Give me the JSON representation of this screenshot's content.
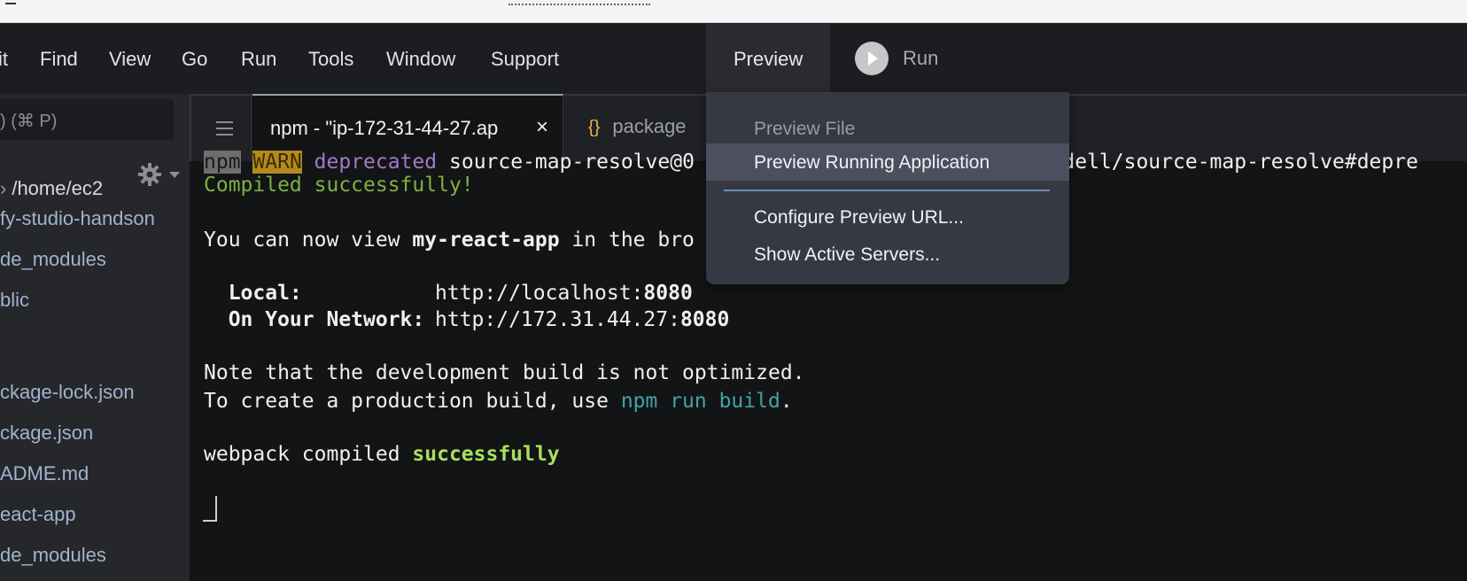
{
  "menubar": {
    "items": [
      "it",
      "Find",
      "View",
      "Go",
      "Run",
      "Tools",
      "Window",
      "Support"
    ],
    "preview_label": "Preview",
    "run_label": "Run"
  },
  "sidebar": {
    "search_text": ") (⌘ P)",
    "tree": [
      "/home/ec2",
      "fy-studio-handson",
      "de_modules",
      "blic",
      "ckage-lock.json",
      "ckage.json",
      "ADME.md",
      "eact-app",
      "de_modules"
    ]
  },
  "tabs": {
    "active_label": "npm - \"ip-172-31-44-27.ap",
    "close_glyph": "×",
    "inactive_icon": "{}",
    "inactive_label": "package"
  },
  "terminal": {
    "line0": {
      "npm": "npm",
      "warn": "WARN",
      "dep": "deprecated",
      "rest": "source-map-resolve@0",
      "tail": "n/lydell/source-map-resolve#depre"
    },
    "compiled": "Compiled successfully!",
    "view_pre": "You can now view ",
    "view_app": "my-react-app",
    "view_post": " in the bro",
    "local_label": "  Local:",
    "local_url": "http://localhost:",
    "local_port": "8080",
    "network_label": "  On Your Network:",
    "network_url": "http://172.31.44.27:",
    "network_port": "8080",
    "note1": "Note that the development build is not optimized.",
    "note2_pre": "To create a production build, use ",
    "note2_cmd": "npm run build",
    "note2_post": ".",
    "webpack_pre": "webpack compiled ",
    "webpack_status": "successfully"
  },
  "dropdown": {
    "items": [
      {
        "label": "Preview File",
        "disabled": true
      },
      {
        "label": "Preview Running Application",
        "highlight": true
      },
      {
        "label": "Configure Preview URL..."
      },
      {
        "label": "Show Active Servers..."
      }
    ]
  },
  "colors": {
    "accent_highlight": "#4b4f5e",
    "success_green": "#7fb042",
    "cmd_cyan": "#42a3a7",
    "warn_yellow": "#b58a1c"
  },
  "icons": [
    "hamburger-icon",
    "close-icon",
    "braces-icon",
    "gear-icon",
    "chevron-down-icon",
    "play-icon"
  ]
}
